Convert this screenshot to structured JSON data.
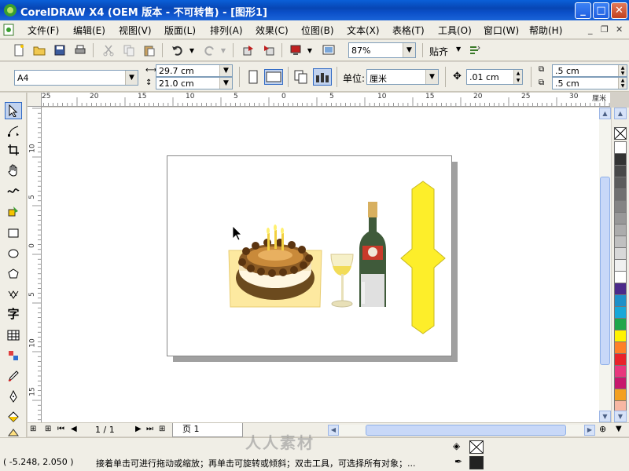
{
  "window": {
    "title": "CorelDRAW X4 (OEM 版本 - 不可转售) - [图形1]",
    "minimize": "_",
    "maximize": "□",
    "close": "✕"
  },
  "menubar": {
    "items": [
      "文件(F)",
      "编辑(E)",
      "视图(V)",
      "版面(L)",
      "排列(A)",
      "效果(C)",
      "位图(B)",
      "文本(X)",
      "表格(T)",
      "工具(O)",
      "窗口(W)",
      "帮助(H)"
    ],
    "mdi": [
      "_",
      "❐",
      "✕"
    ]
  },
  "toolbar1": {
    "zoom": "87%",
    "snap": "贴齐"
  },
  "property_bar": {
    "paper_size": "A4",
    "width": "29.7 cm",
    "height": "21.0 cm",
    "units_label": "单位:",
    "units_value": "厘米",
    "nudge": ".01 cm",
    "dup_x": ".5 cm",
    "dup_y": ".5 cm"
  },
  "rulers": {
    "top_labels": [
      "25",
      "20",
      "15",
      "10",
      "5",
      "0",
      "5",
      "10",
      "15",
      "20",
      "25",
      "30"
    ],
    "unit_label": "厘米",
    "left_labels": [
      "10",
      "5",
      "0",
      "5",
      "10",
      "15"
    ]
  },
  "navigator": {
    "page_count": "1 / 1",
    "page_tab": "页 1"
  },
  "status": {
    "coords": "( -5.248, 2.050 )",
    "hint": "接着单击可进行拖动或缩放；再单击可旋转或倾斜；双击工具，可选择所有对象；...",
    "watermark": "人人素材"
  },
  "palette_colors": [
    "#ffffff",
    "#333333",
    "#484848",
    "#5c5c5c",
    "#707070",
    "#848484",
    "#989898",
    "#acacac",
    "#c0c0c0",
    "#d8d8d8",
    "#f0f0f0",
    "#ffffff",
    "#4b2a8a",
    "#1e90c8",
    "#18a8d8",
    "#1fa64a",
    "#fff200",
    "#ff7f27",
    "#e8232a",
    "#e8377d",
    "#c7176c",
    "#f4a020",
    "#f7b7a3"
  ],
  "icons": {
    "title_app": "coreldraw-app-icon",
    "toolbox": [
      "pick-tool-icon",
      "shape-tool-icon",
      "crop-tool-icon",
      "pan-tool-icon",
      "freehand-tool-icon",
      "smart-fill-icon",
      "rectangle-tool-icon",
      "ellipse-tool-icon",
      "polygon-tool-icon",
      "basic-shapes-icon",
      "text-tool-icon",
      "table-tool-icon",
      "interactive-blend-icon",
      "eyedropper-icon",
      "outline-pen-icon",
      "fill-tool-icon",
      "interactive-fill-icon"
    ]
  }
}
